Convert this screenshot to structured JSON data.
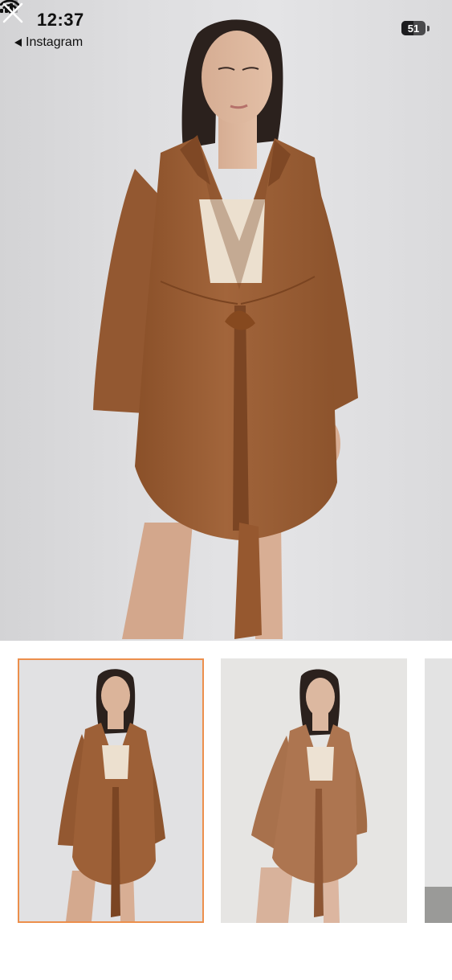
{
  "status_bar": {
    "time": "12:37",
    "back_app_label": "Instagram",
    "battery_level": "51",
    "icons": [
      "signal-icon",
      "wifi-icon",
      "battery-icon"
    ]
  },
  "viewer": {
    "close_icon": "close-icon",
    "main_image": "woman-in-brown-linen-tie-front-shirt-dress",
    "thumbnails": [
      {
        "image": "brown-linen-shirt-front-view",
        "selected": true
      },
      {
        "image": "brown-linen-shirt-hand-in-pocket",
        "selected": false
      },
      {
        "image": "partial-third-thumbnail",
        "selected": false
      }
    ]
  },
  "colors": {
    "selection_border": "#ec8f4c",
    "garment": "#9a5d35",
    "background": "#e1e1e3"
  }
}
